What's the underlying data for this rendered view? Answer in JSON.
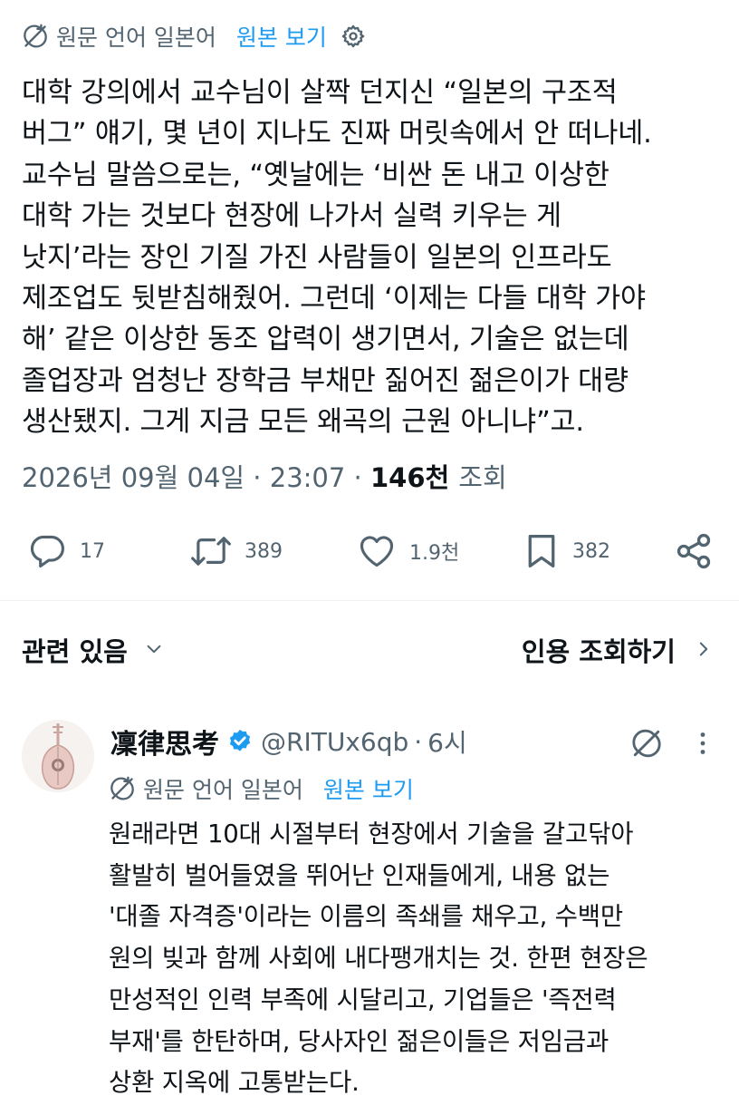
{
  "translation": {
    "source_label": "원문 언어 일본어",
    "view_original": "원본 보기"
  },
  "tweet": {
    "lines": [
      "대학 강의에서 교수님이 살짝 던지신 “일본의 구조적",
      "버그” 얘기, 몇 년이 지나도 진짜 머릿속에서 안 떠나네.",
      "교수님 말씀으로는, “옛날에는 ‘비싼 돈 내고 이상한",
      "대학 가는 것보다 현장에 나가서 실력 키우는 게",
      "낫지’라는 장인 기질 가진 사람들이 일본의 인프라도",
      "제조업도 뒷받침해줬어. 그런데 ‘이제는 다들 대학 가야",
      "해’ 같은 이상한 동조 압력이 생기면서, 기술은 없는데",
      "졸업장과 엄청난 장학금 부채만 짊어진 젊은이가 대량",
      "생산됐지. 그게 지금 모든 왜곡의 근원 아니냐”고."
    ],
    "date": "2026년 09월 04일 · 23:07 ·",
    "views_count": "146천",
    "views_label": "조회"
  },
  "actions": {
    "replies": "17",
    "retweets": "389",
    "likes": "1.9천",
    "bookmarks": "382"
  },
  "related": {
    "label": "관련 있음",
    "quote_views": "인용 조회하기"
  },
  "reply": {
    "name": "凜律思考",
    "handle": "@RITUx6qb",
    "dot": "·",
    "time": "6시",
    "lines": [
      "원래라면 10대 시절부터 현장에서 기술을 갈고닦아",
      "활발히 벌어들였을 뛰어난 인재들에게, 내용 없는",
      "'대졸 자격증'이라는 이름의 족쇄를 채우고, 수백만",
      "원의 빚과 함께 사회에 내다팽개치는 것. 한편 현장은",
      "만성적인 인력 부족에 시달리고, 기업들은 '즉전력",
      "부재'를 한탄하며, 당사자인 젊은이들은 저임금과",
      "상환 지옥에 고통받는다."
    ]
  },
  "colors": {
    "text": "#0f1419",
    "secondary": "#536471",
    "accent": "#1d9bf0",
    "divider": "#eff3f4"
  }
}
